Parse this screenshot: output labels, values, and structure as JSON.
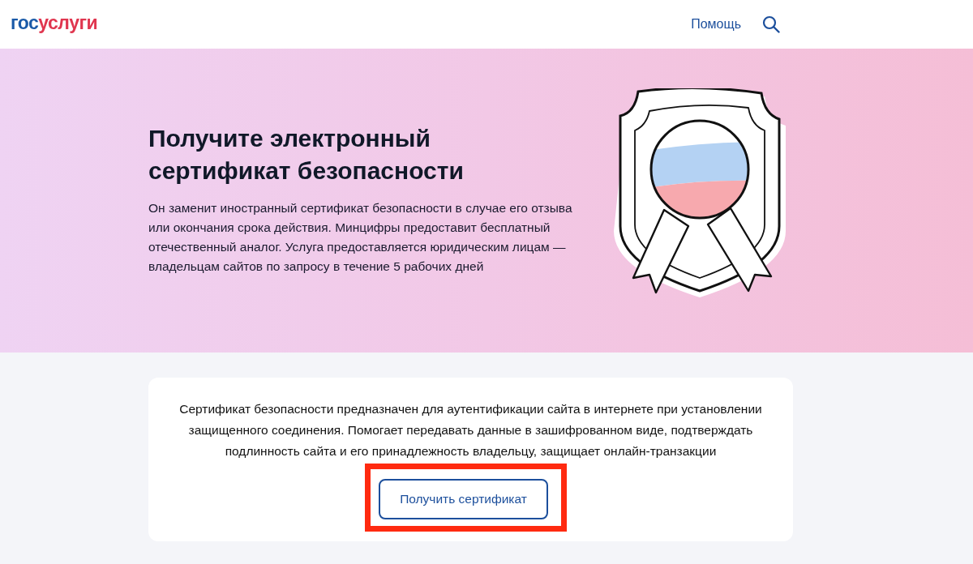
{
  "header": {
    "logo": {
      "prefix": "гос",
      "suffix": "услуги"
    },
    "help_link": "Помощь"
  },
  "hero": {
    "title": "Получите электронный сертификат безопасности",
    "description": "Он заменит иностранный сертификат безопасности в случае его отзыва или окончания срока действия. Минцифры предоставит бесплатный отечественный аналог. Услуга предоставляется юридическим лицам — владельцам сайтов по запросу в течение 5 рабочих дней"
  },
  "info_card": {
    "text": "Сертификат безопасности предназначен для аутентификации сайта в интернете при установлении защищенного соединения. Помогает передавать данные в зашифрованном виде, подтверждать подлинность сайта и его принадлежность владельцу, защищает онлайн-транзакции",
    "button": "Получить сертификат",
    "button_highlighted": true
  }
}
